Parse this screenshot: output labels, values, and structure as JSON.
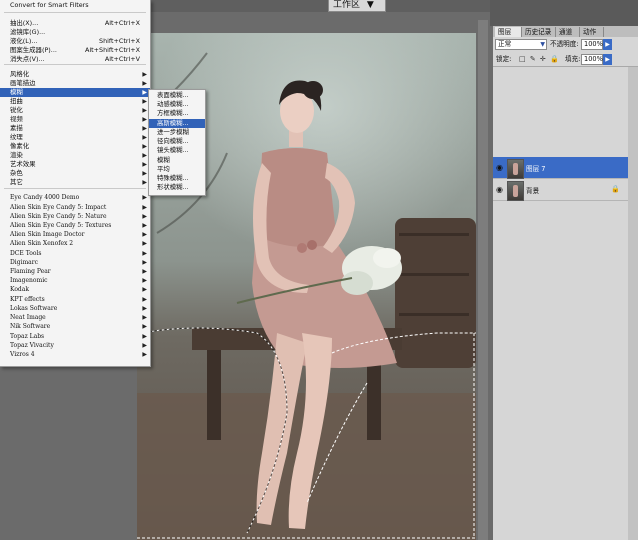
{
  "topbar": {
    "workspace_label": "工作区",
    "workspace_arrow": "▼"
  },
  "filter_menu": {
    "items": [
      {
        "label": "Convert for Smart Filters",
        "shortcut": "",
        "arrow": false
      },
      {
        "label": "抽出(X)...",
        "shortcut": "Alt+Ctrl+X",
        "arrow": false
      },
      {
        "label": "滤镜库(G)...",
        "shortcut": "",
        "arrow": false
      },
      {
        "label": "液化(L)...",
        "shortcut": "Shift+Ctrl+X",
        "arrow": false
      },
      {
        "label": "图案生成器(P)...",
        "shortcut": "Alt+Shift+Ctrl+X",
        "arrow": false
      },
      {
        "label": "消失点(V)...",
        "shortcut": "Alt+Ctrl+V",
        "arrow": false
      },
      {
        "label": "风格化",
        "shortcut": "",
        "arrow": true
      },
      {
        "label": "画笔描边",
        "shortcut": "",
        "arrow": true
      },
      {
        "label": "模糊",
        "shortcut": "",
        "arrow": true
      },
      {
        "label": "扭曲",
        "shortcut": "",
        "arrow": true
      },
      {
        "label": "锐化",
        "shortcut": "",
        "arrow": true
      },
      {
        "label": "视频",
        "shortcut": "",
        "arrow": true
      },
      {
        "label": "素描",
        "shortcut": "",
        "arrow": true
      },
      {
        "label": "纹理",
        "shortcut": "",
        "arrow": true
      },
      {
        "label": "像素化",
        "shortcut": "",
        "arrow": true
      },
      {
        "label": "渲染",
        "shortcut": "",
        "arrow": true
      },
      {
        "label": "艺术效果",
        "shortcut": "",
        "arrow": true
      },
      {
        "label": "杂色",
        "shortcut": "",
        "arrow": true
      },
      {
        "label": "其它",
        "shortcut": "",
        "arrow": true
      },
      {
        "label": "Eye Candy 4000 Demo",
        "shortcut": "",
        "arrow": true
      },
      {
        "label": "Alien Skin Eye Candy 5: Impact",
        "shortcut": "",
        "arrow": true
      },
      {
        "label": "Alien Skin Eye Candy 5: Nature",
        "shortcut": "",
        "arrow": true
      },
      {
        "label": "Alien Skin Eye Candy 5: Textures",
        "shortcut": "",
        "arrow": true
      },
      {
        "label": "Alien Skin Image Doctor",
        "shortcut": "",
        "arrow": true
      },
      {
        "label": "Alien Skin Xenofex 2",
        "shortcut": "",
        "arrow": true
      },
      {
        "label": "DCE Tools",
        "shortcut": "",
        "arrow": true
      },
      {
        "label": "Digimarc",
        "shortcut": "",
        "arrow": true
      },
      {
        "label": "Flaming Pear",
        "shortcut": "",
        "arrow": true
      },
      {
        "label": "Imagenomic",
        "shortcut": "",
        "arrow": true
      },
      {
        "label": "Kodak",
        "shortcut": "",
        "arrow": true
      },
      {
        "label": "KPT effects",
        "shortcut": "",
        "arrow": true
      },
      {
        "label": "Lokas Software",
        "shortcut": "",
        "arrow": true
      },
      {
        "label": "Neat Image",
        "shortcut": "",
        "arrow": true
      },
      {
        "label": "Nik Software",
        "shortcut": "",
        "arrow": true
      },
      {
        "label": "Topaz Labs",
        "shortcut": "",
        "arrow": true
      },
      {
        "label": "Topaz Vivacity",
        "shortcut": "",
        "arrow": true
      },
      {
        "label": "Vizros 4",
        "shortcut": "",
        "arrow": true
      }
    ]
  },
  "blur_submenu": {
    "items": [
      "表面模糊...",
      "动感模糊...",
      "方框模糊...",
      "高斯模糊...",
      "进一步模糊",
      "径向模糊...",
      "镜头模糊...",
      "模糊",
      "平均",
      "特殊模糊...",
      "形状模糊..."
    ]
  },
  "layers_panel": {
    "tabs": [
      "图层 ×",
      "历史记录",
      "通道",
      "动作"
    ],
    "blend_mode": "正常",
    "opacity_label": "不透明度:",
    "opacity_value": "100%",
    "lock_label": "锁定:",
    "lock_icons": "□ ✎ ✛ 🔒",
    "fill_label": "填充:",
    "fill_value": "100%",
    "layers": [
      {
        "name": "图层 7",
        "selected": true,
        "locked": false
      },
      {
        "name": "背景",
        "selected": false,
        "locked": true
      }
    ]
  },
  "colors": {
    "menu_highlight": "#3162b8",
    "layer_selected": "#3a6bc6"
  }
}
